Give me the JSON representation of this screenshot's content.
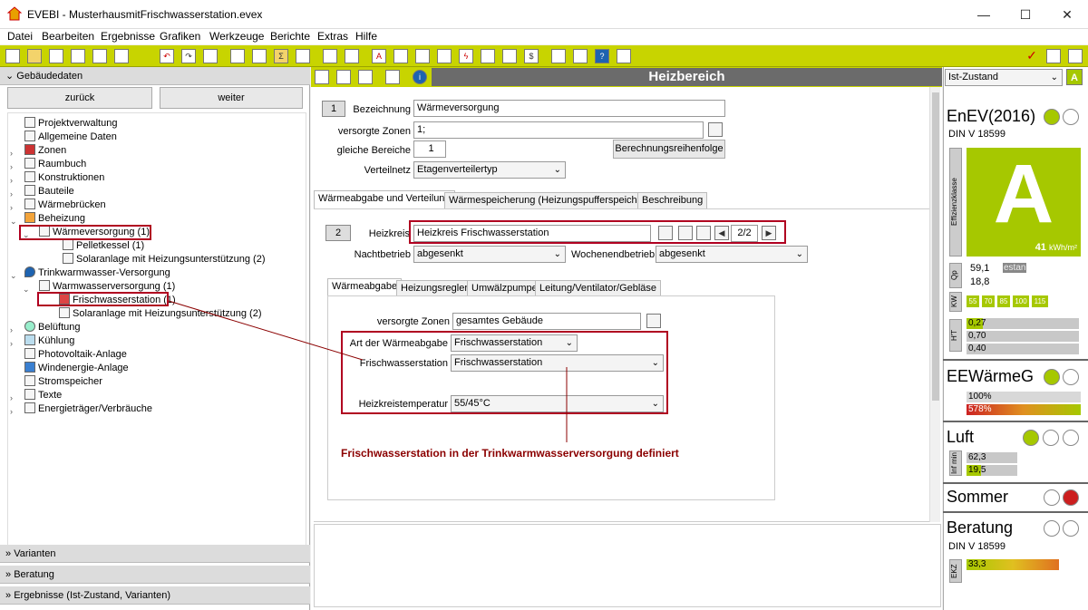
{
  "window": {
    "title": "EVEBI - MusterhausmitFrischwasserstation.evex",
    "minimize": "—",
    "maximize": "☐",
    "close": "✕"
  },
  "menu": [
    "Datei",
    "Bearbeiten",
    "Ergebnisse",
    "Grafiken",
    "Werkzeuge",
    "Berichte",
    "Extras",
    "Hilfe"
  ],
  "left": {
    "header": "Gebäudedaten",
    "back": "zurück",
    "next": "weiter",
    "tree": [
      "Projektverwaltung",
      "Allgemeine Daten",
      "Zonen",
      "Raumbuch",
      "Konstruktionen",
      "Bauteile",
      "Wärmebrücken",
      "Beheizung",
      "Wärmeversorgung (1)",
      "Pelletkessel (1)",
      "Solaranlage mit Heizungsunterstützung (2)",
      "Trinkwarmwasser-Versorgung",
      "Warmwasserversorgung (1)",
      "Frischwasserstation (1)",
      "Solaranlage mit Heizungsunterstützung (2)",
      "Belüftung",
      "Kühlung",
      "Photovoltaik-Anlage",
      "Windenergie-Anlage",
      "Stromspeicher",
      "Texte",
      "Energieträger/Verbräuche"
    ],
    "sections": [
      "Varianten",
      "Beratung",
      "Ergebnisse (Ist-Zustand, Varianten)"
    ]
  },
  "main": {
    "title": "Heizbereich",
    "num1": "1",
    "bezeichnung_label": "Bezeichnung",
    "bezeichnung": "Wärmeversorgung",
    "zonen_label": "versorgte Zonen",
    "zonen": "1;",
    "bereiche_label": "gleiche Bereiche",
    "bereiche": "1",
    "reihenfolge": "Berechnungsreihenfolge",
    "netz_label": "Verteilnetz",
    "netz": "Etagenverteilertyp",
    "tabs1": [
      "Wärmeabgabe und Verteilung",
      "Wärmespeicherung (Heizungspufferspeicher)",
      "Beschreibung"
    ],
    "num2": "2",
    "heizkreis_label": "Heizkreis",
    "heizkreis": "Heizkreis Frischwasserstation",
    "pager": "2/2",
    "nacht_label": "Nachtbetrieb",
    "nacht": "abgesenkt",
    "woche_label": "Wochenendbetrieb",
    "woche": "abgesenkt",
    "tabs2": [
      "Wärmeabgabe",
      "Heizungsregler",
      "Umwälzpumpe",
      "Leitung/Ventilator/Gebläse"
    ],
    "vz_label": "versorgte Zonen",
    "vz": "gesamtes Gebäude",
    "art_label": "Art der Wärmeabgabe",
    "art": "Frischwasserstation",
    "fws_label": "Frischwasserstation",
    "fws": "Frischwasserstation",
    "temp_label": "Heizkreistemperatur",
    "temp": "55/45°C",
    "annotation": "Frischwasserstation in der Trinkwarmwasserversorgung definiert"
  },
  "right": {
    "state": "Ist-Zustand",
    "state_badge": "A",
    "enev": "EnEV(2016)",
    "din1": "DIN V 18599",
    "eff_label": "Effizienzklasse",
    "eff_class": "A",
    "eff_value": "41",
    "eff_unit": "kWh/m²",
    "qp_label": "Qp",
    "qp1": "59,1",
    "qp_estan": "estan",
    "qp2": "18,8",
    "kw_label": "KW",
    "kw": [
      "55",
      "70",
      "85",
      "100",
      "115"
    ],
    "ht_label": "H'T",
    "ht": [
      "0,27",
      "0,70",
      "0,40"
    ],
    "eew": "EEWärmeG",
    "eew1": "100%",
    "eew2": "578%",
    "luft": "Luft",
    "inf_label": "Inf min",
    "luft1": "62,3",
    "luft2": "19,5",
    "sommer": "Sommer",
    "beratung": "Beratung",
    "din2": "DIN V 18599",
    "ekz_label": "EKZ",
    "ekz": "33,3"
  }
}
